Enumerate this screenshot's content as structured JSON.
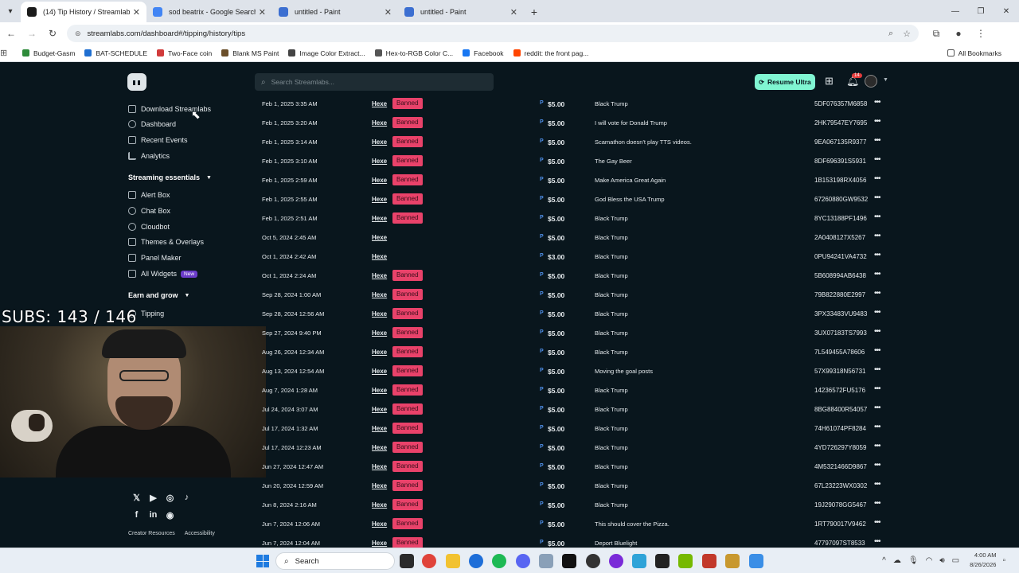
{
  "browser": {
    "tabs": [
      {
        "title": "(14) Tip History / Streamlabs",
        "active": true,
        "icon_color": "#1b1b1b"
      },
      {
        "title": "sod beatrix - Google Search",
        "active": false,
        "icon_color": "#4285f4"
      },
      {
        "title": "untitled - Paint",
        "active": false,
        "icon_color": "#3c6fd1"
      },
      {
        "title": "untitled - Paint",
        "active": false,
        "icon_color": "#3c6fd1"
      }
    ],
    "url": "streamlabs.com/dashboard#/tipping/history/tips",
    "bookmarks": [
      {
        "label": "Budget-Gasm",
        "color": "#2e8b3a"
      },
      {
        "label": "BAT-SCHEDULE",
        "color": "#1f6fd1"
      },
      {
        "label": "Two-Face coin",
        "color": "#d13b3b"
      },
      {
        "label": "Blank MS Paint",
        "color": "#6b4f2a"
      },
      {
        "label": "Image Color Extract...",
        "color": "#444444"
      },
      {
        "label": "Hex-to-RGB Color C...",
        "color": "#555555"
      },
      {
        "label": "Facebook",
        "color": "#1877f2"
      },
      {
        "label": "reddit: the front pag...",
        "color": "#ff4500"
      }
    ],
    "all_bookmarks": "All Bookmarks"
  },
  "header": {
    "search_placeholder": "Search Streamlabs...",
    "resume_label": "Resume Ultra",
    "notification_count": "14"
  },
  "sidebar": {
    "items": [
      {
        "label": "Download Streamlabs"
      },
      {
        "label": "Dashboard"
      },
      {
        "label": "Recent Events"
      },
      {
        "label": "Analytics"
      }
    ],
    "streaming_essentials": "Streaming essentials",
    "essentials": [
      {
        "label": "Alert Box"
      },
      {
        "label": "Chat Box"
      },
      {
        "label": "Cloudbot"
      },
      {
        "label": "Themes & Overlays"
      },
      {
        "label": "Panel Maker"
      },
      {
        "label": "All Widgets"
      }
    ],
    "new_badge": "New",
    "earn_and_grow": "Earn and grow",
    "earn_items": [
      {
        "label": "Tipping"
      }
    ],
    "footer": [
      "Creator Resources",
      "Accessibility"
    ]
  },
  "overlay": {
    "subs": "SUBS: 143 / 146"
  },
  "tips": [
    {
      "date": "Feb 1, 2025 3:35 AM",
      "user": "Hexe",
      "banned": true,
      "amount": "$5.00",
      "message": "Black Trump",
      "id": "5DF076357M6858"
    },
    {
      "date": "Feb 1, 2025 3:20 AM",
      "user": "Hexe",
      "banned": true,
      "amount": "$5.00",
      "message": "I will vote for Donald Trump",
      "id": "2HK79547EY7695"
    },
    {
      "date": "Feb 1, 2025 3:14 AM",
      "user": "Hexe",
      "banned": true,
      "amount": "$5.00",
      "message": "Scamathon doesn't play TTS videos.",
      "id": "9EA067135R9377"
    },
    {
      "date": "Feb 1, 2025 3:10 AM",
      "user": "Hexe",
      "banned": true,
      "amount": "$5.00",
      "message": "The Gay Beer",
      "id": "8DF696391S5931"
    },
    {
      "date": "Feb 1, 2025 2:59 AM",
      "user": "Hexe",
      "banned": true,
      "amount": "$5.00",
      "message": "Make America Great Again",
      "id": "1B153198RX4056"
    },
    {
      "date": "Feb 1, 2025 2:55 AM",
      "user": "Hexe",
      "banned": true,
      "amount": "$5.00",
      "message": "God Bless the USA Trump",
      "id": "67260880GW9532"
    },
    {
      "date": "Feb 1, 2025 2:51 AM",
      "user": "Hexe",
      "banned": true,
      "amount": "$5.00",
      "message": "Black Trump",
      "id": "8YC13188PF1496"
    },
    {
      "date": "Oct 5, 2024 2:45 AM",
      "user": "Hexe",
      "banned": false,
      "amount": "$5.00",
      "message": "Black Trump",
      "id": "2A0408127X5267"
    },
    {
      "date": "Oct 1, 2024 2:42 AM",
      "user": "Hexe",
      "banned": false,
      "amount": "$3.00",
      "message": "Black Trump",
      "id": "0PU94241VA4732"
    },
    {
      "date": "Oct 1, 2024 2:24 AM",
      "user": "Hexe",
      "banned": true,
      "amount": "$5.00",
      "message": "Black Trump",
      "id": "5B608994AB6438"
    },
    {
      "date": "Sep 28, 2024 1:00 AM",
      "user": "Hexe",
      "banned": true,
      "amount": "$5.00",
      "message": "Black Trump",
      "id": "79B822880E2997"
    },
    {
      "date": "Sep 28, 2024 12:56 AM",
      "user": "Hexe",
      "banned": true,
      "amount": "$5.00",
      "message": "Black Trump",
      "id": "3PX33483VU9483"
    },
    {
      "date": "Sep 27, 2024 9:40 PM",
      "user": "Hexe",
      "banned": true,
      "amount": "$5.00",
      "message": "Black Trump",
      "id": "3UX07183TS7993"
    },
    {
      "date": "Aug 26, 2024 12:34 AM",
      "user": "Hexe",
      "banned": true,
      "amount": "$5.00",
      "message": "Black Trump",
      "id": "7L549455A78606"
    },
    {
      "date": "Aug 13, 2024 12:54 AM",
      "user": "Hexe",
      "banned": true,
      "amount": "$5.00",
      "message": "Moving the goal posts",
      "id": "57X99318N56731"
    },
    {
      "date": "Aug 7, 2024 1:28 AM",
      "user": "Hexe",
      "banned": true,
      "amount": "$5.00",
      "message": "Black Trump",
      "id": "14236572FU5176"
    },
    {
      "date": "Jul 24, 2024 3:07 AM",
      "user": "Hexe",
      "banned": true,
      "amount": "$5.00",
      "message": "Black Trump",
      "id": "8BG88400R54057"
    },
    {
      "date": "Jul 17, 2024 1:32 AM",
      "user": "Hexe",
      "banned": true,
      "amount": "$5.00",
      "message": "Black Trump",
      "id": "74H61074PF8284"
    },
    {
      "date": "Jul 17, 2024 12:23 AM",
      "user": "Hexe",
      "banned": true,
      "amount": "$5.00",
      "message": "Black Trump",
      "id": "4YD726297Y8059"
    },
    {
      "date": "Jun 27, 2024 12:47 AM",
      "user": "Hexe",
      "banned": true,
      "amount": "$5.00",
      "message": "Black Trump",
      "id": "4M5321466D9867"
    },
    {
      "date": "Jun 20, 2024 12:59 AM",
      "user": "Hexe",
      "banned": true,
      "amount": "$5.00",
      "message": "Black Trump",
      "id": "67L23223WX0302"
    },
    {
      "date": "Jun 8, 2024 2:16 AM",
      "user": "Hexe",
      "banned": true,
      "amount": "$5.00",
      "message": "Black Trump",
      "id": "19J29078GG5467"
    },
    {
      "date": "Jun 7, 2024 12:06 AM",
      "user": "Hexe",
      "banned": true,
      "amount": "$5.00",
      "message": "This should cover the Pizza.",
      "id": "1RT790017V9462"
    },
    {
      "date": "Jun 7, 2024 12:04 AM",
      "user": "Hexe",
      "banned": true,
      "amount": "$5.00",
      "message": "Deport Bluelight",
      "id": "47797097ST8533"
    }
  ],
  "banned_label": "Banned",
  "taskbar": {
    "search_label": "Search",
    "time": "4:00 AM",
    "date": "8/26/2026"
  }
}
